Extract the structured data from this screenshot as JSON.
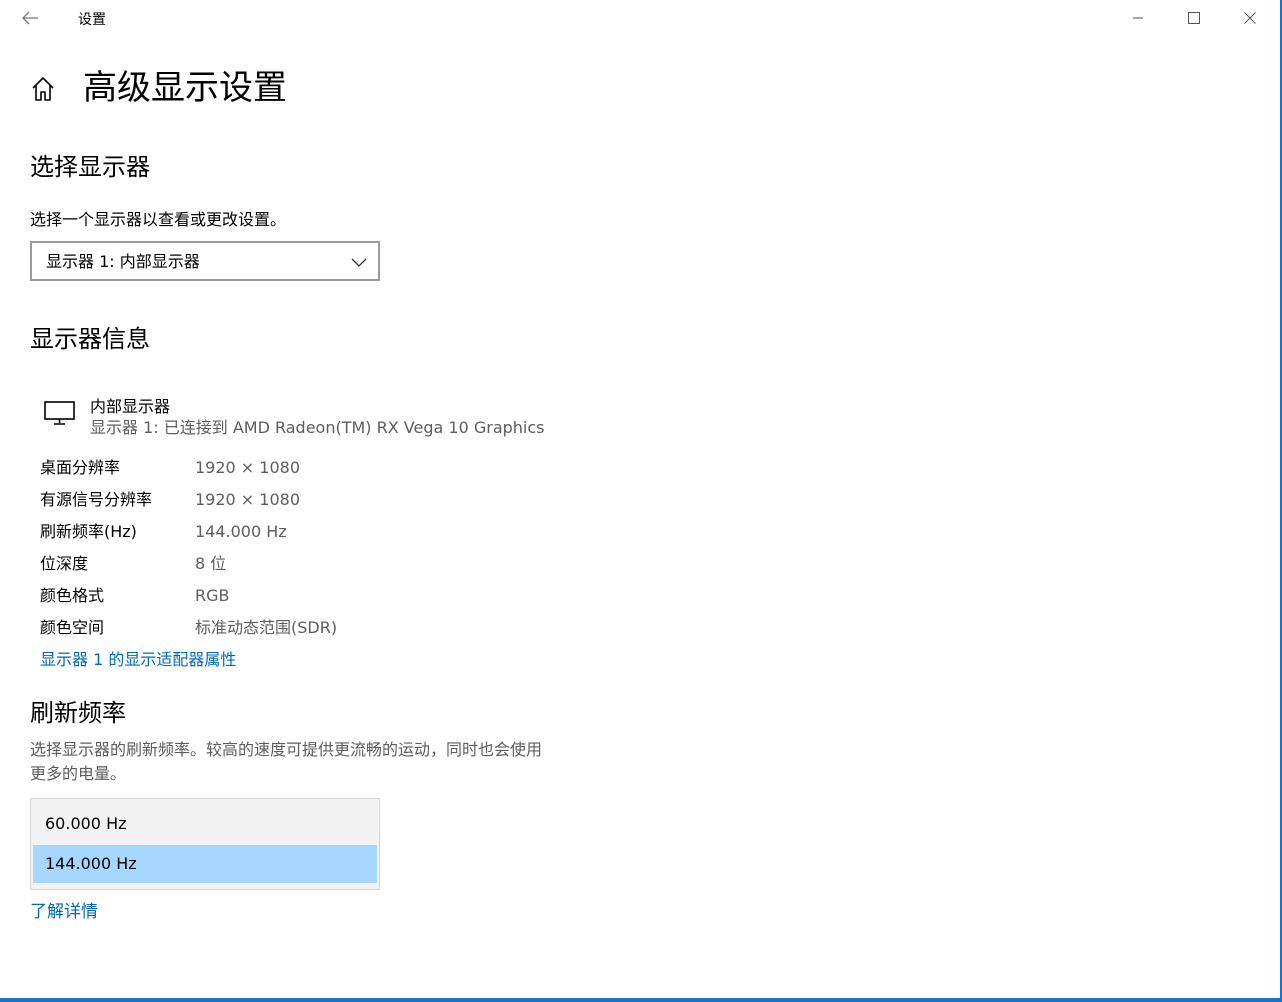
{
  "window": {
    "title": "设置"
  },
  "page": {
    "title": "高级显示设置"
  },
  "select_display": {
    "heading": "选择显示器",
    "description": "选择一个显示器以查看或更改设置。",
    "selected": "显示器 1: 内部显示器"
  },
  "display_info": {
    "heading": "显示器信息",
    "monitor_name": "内部显示器",
    "monitor_detail": "显示器 1: 已连接到 AMD Radeon(TM) RX Vega 10 Graphics",
    "rows": [
      {
        "label": "桌面分辨率",
        "value": "1920 × 1080"
      },
      {
        "label": "有源信号分辨率",
        "value": "1920 × 1080"
      },
      {
        "label": "刷新频率(Hz)",
        "value": "144.000 Hz"
      },
      {
        "label": "位深度",
        "value": "8 位"
      },
      {
        "label": "颜色格式",
        "value": "RGB"
      },
      {
        "label": "颜色空间",
        "value": "标准动态范围(SDR)"
      }
    ],
    "adapter_link": "显示器 1 的显示适配器属性"
  },
  "refresh_rate": {
    "heading": "刷新频率",
    "description_line1": "选择显示器的刷新频率。较高的速度可提供更流畅的运动，同时也会使用",
    "description_line2": "更多的电量。",
    "options": [
      "60.000 Hz",
      "144.000 Hz"
    ],
    "selected_index": 1,
    "learn_more": "了解详情"
  },
  "icons": {
    "back": "back-arrow-icon",
    "minimize": "minimize-icon",
    "maximize": "maximize-icon",
    "close": "close-icon",
    "home": "home-icon",
    "chevron": "chevron-down-icon",
    "monitor": "monitor-icon"
  },
  "colors": {
    "accent": "#0067c0",
    "selected_bg": "#a6d8ff",
    "window_border": "#1a73c8"
  }
}
